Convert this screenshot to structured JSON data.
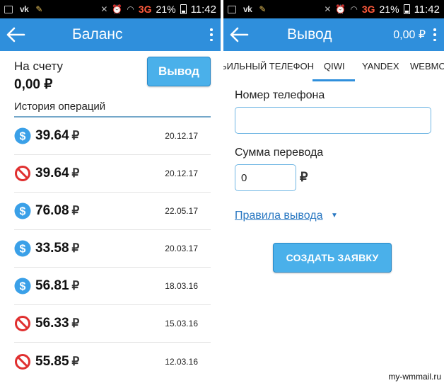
{
  "colors": {
    "appbar": "#2f8fdc",
    "button": "#4ab0ea",
    "link": "#2a78c2",
    "success": "#3aa0e8",
    "cancel": "#e03030"
  },
  "status_bar": {
    "left": {
      "battery_pct": "21%",
      "time": "11:42",
      "network": "3G"
    },
    "right": {
      "battery_pct": "21%",
      "time": "11:42",
      "network": "3G"
    }
  },
  "balance_screen": {
    "title": "Баланс",
    "account_label": "На счету",
    "account_value": "0,00 ₽",
    "withdraw_button": "Вывод",
    "history_header": "История операций",
    "operations": [
      {
        "icon": "dollar-icon",
        "amount": "39.64",
        "currency": "₽",
        "date": "20.12.17"
      },
      {
        "icon": "cancel-icon",
        "amount": "39.64",
        "currency": "₽",
        "date": "20.12.17"
      },
      {
        "icon": "dollar-icon",
        "amount": "76.08",
        "currency": "₽",
        "date": "22.05.17"
      },
      {
        "icon": "dollar-icon",
        "amount": "33.58",
        "currency": "₽",
        "date": "20.03.17"
      },
      {
        "icon": "dollar-icon",
        "amount": "56.81",
        "currency": "₽",
        "date": "18.03.16"
      },
      {
        "icon": "cancel-icon",
        "amount": "56.33",
        "currency": "₽",
        "date": "15.03.16"
      },
      {
        "icon": "cancel-icon",
        "amount": "55.85",
        "currency": "₽",
        "date": "12.03.16"
      }
    ]
  },
  "withdraw_screen": {
    "title": "Вывод",
    "balance": "0,00 ₽",
    "tabs": [
      {
        "label": "ЬИЛЬНЫЙ ТЕЛЕФОН",
        "active": false
      },
      {
        "label": "QIWI",
        "active": true
      },
      {
        "label": "YANDEX",
        "active": false
      },
      {
        "label": "WEBMO",
        "active": false
      }
    ],
    "phone_label": "Номер телефона",
    "phone_value": "",
    "sum_label": "Сумма перевода",
    "sum_value": "0",
    "currency": "₽",
    "rules_link": "Правила вывода",
    "create_button": "СОЗДАТЬ ЗАЯВКУ"
  },
  "watermark": "my-wmmail.ru"
}
